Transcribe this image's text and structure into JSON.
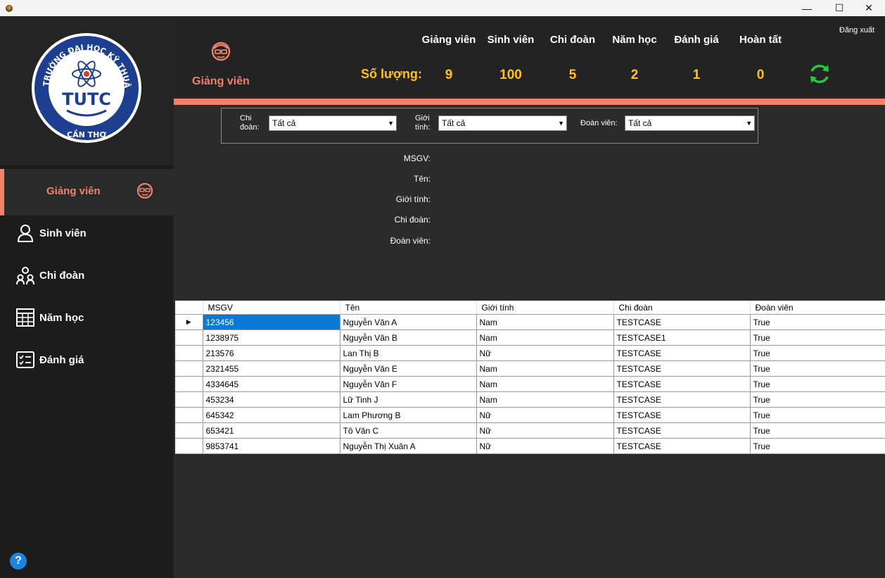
{
  "window": {
    "minimize_glyph": "—",
    "maximize_glyph": "☐",
    "close_glyph": "✕"
  },
  "sidebar": {
    "logo": {
      "ring_text": "TRƯỜNG ĐẠI HỌC KỸ THUẬT - CÔNG NGHỆ",
      "bottom_text": "CẦN THƠ",
      "emblem_text": "TUTC"
    },
    "items": [
      {
        "label": "Giảng viên",
        "icon": "teacher-icon",
        "active": true
      },
      {
        "label": "Sinh viên",
        "icon": "student-icon"
      },
      {
        "label": "Chi đoàn",
        "icon": "group-icon"
      },
      {
        "label": "Năm học",
        "icon": "calendar-grid-icon"
      },
      {
        "label": "Đánh giá",
        "icon": "checklist-icon"
      }
    ],
    "help_label": "?"
  },
  "header": {
    "title": "Giảng viên",
    "logout": "Đăng xuất",
    "count_label": "Số lượng:",
    "stats": [
      {
        "label": "Giảng viên",
        "value": "9"
      },
      {
        "label": "Sinh viên",
        "value": "100"
      },
      {
        "label": "Chi đoàn",
        "value": "5"
      },
      {
        "label": "Năm học",
        "value": "2"
      },
      {
        "label": "Đánh giá",
        "value": "1"
      },
      {
        "label": "Hoàn tất",
        "value": "0"
      }
    ]
  },
  "colors": {
    "accent": "#f0826a",
    "stat_value": "#ffc21a",
    "refresh": "#27c93f"
  },
  "filters": [
    {
      "label": "Chi đoàn:",
      "value": "Tất cả"
    },
    {
      "label": "Giới tính:",
      "value": "Tất cả"
    },
    {
      "label": "Đoàn viên:",
      "value": "Tất cả"
    }
  ],
  "details": {
    "msgv": "MSGV:",
    "ten": "Tên:",
    "gioi_tinh": "Giới tính:",
    "chi_doan": "Chi đoàn:",
    "doan_vien": "Đoàn viên:"
  },
  "table": {
    "columns": [
      "MSGV",
      "Tên",
      "Giới tính",
      "Chi đoàn",
      "Đoàn viên"
    ],
    "rows": [
      [
        "123456",
        "Nguyễn Văn A",
        "Nam",
        "TESTCASE",
        "True"
      ],
      [
        "1238975",
        "Nguyễn Văn B",
        "Nam",
        "TESTCASE1",
        "True"
      ],
      [
        "213576",
        "Lan Thị B",
        "Nữ",
        "TESTCASE",
        "True"
      ],
      [
        "2321455",
        "Nguyễn Văn E",
        "Nam",
        "TESTCASE",
        "True"
      ],
      [
        "4334645",
        "Nguyễn Văn F",
        "Nam",
        "TESTCASE",
        "True"
      ],
      [
        "453234",
        "Lữ Tinh J",
        "Nam",
        "TESTCASE",
        "True"
      ],
      [
        "645342",
        "Lam Phương B",
        "Nữ",
        "TESTCASE",
        "True"
      ],
      [
        "653421",
        "Tô Văn C",
        "Nữ",
        "TESTCASE",
        "True"
      ],
      [
        "9853741",
        "Nguyễn Thị Xuân A",
        "Nữ",
        "TESTCASE",
        "True"
      ]
    ],
    "current_row_marker": "▶"
  }
}
